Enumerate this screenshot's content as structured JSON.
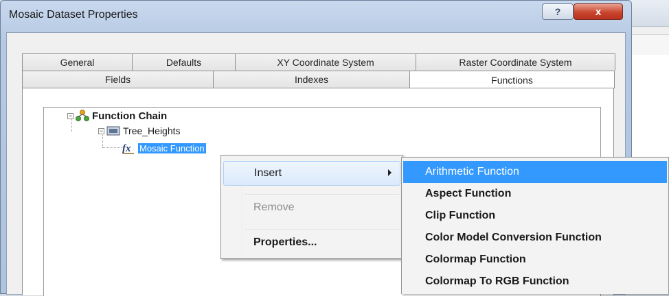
{
  "dialog": {
    "title": "Mosaic Dataset Properties",
    "help_label": "?",
    "close_label": "x"
  },
  "tabs": {
    "top_row": [
      "General",
      "Defaults",
      "XY Coordinate System",
      "Raster Coordinate System"
    ],
    "bottom_row": [
      "Fields",
      "Indexes",
      "Functions"
    ],
    "selected": "Functions"
  },
  "tree": {
    "root": {
      "label": "Function Chain",
      "icon": "function-chain-icon"
    },
    "raster": {
      "label": "Tree_Heights",
      "icon": "raster-icon"
    },
    "function": {
      "label": "Mosaic Function",
      "icon": "function-fx-icon"
    }
  },
  "context_menu": {
    "insert": "Insert",
    "remove": "Remove",
    "properties": "Properties..."
  },
  "submenu": {
    "items": [
      "Arithmetic Function",
      "Aspect Function",
      "Clip Function",
      "Color Model Conversion Function",
      "Colormap Function",
      "Colormap To RGB Function"
    ],
    "highlighted": "Arithmetic Function"
  },
  "colors": {
    "selection": "#3399ff",
    "close_button": "#c9452e",
    "title_bar": "#b5c9e3"
  }
}
